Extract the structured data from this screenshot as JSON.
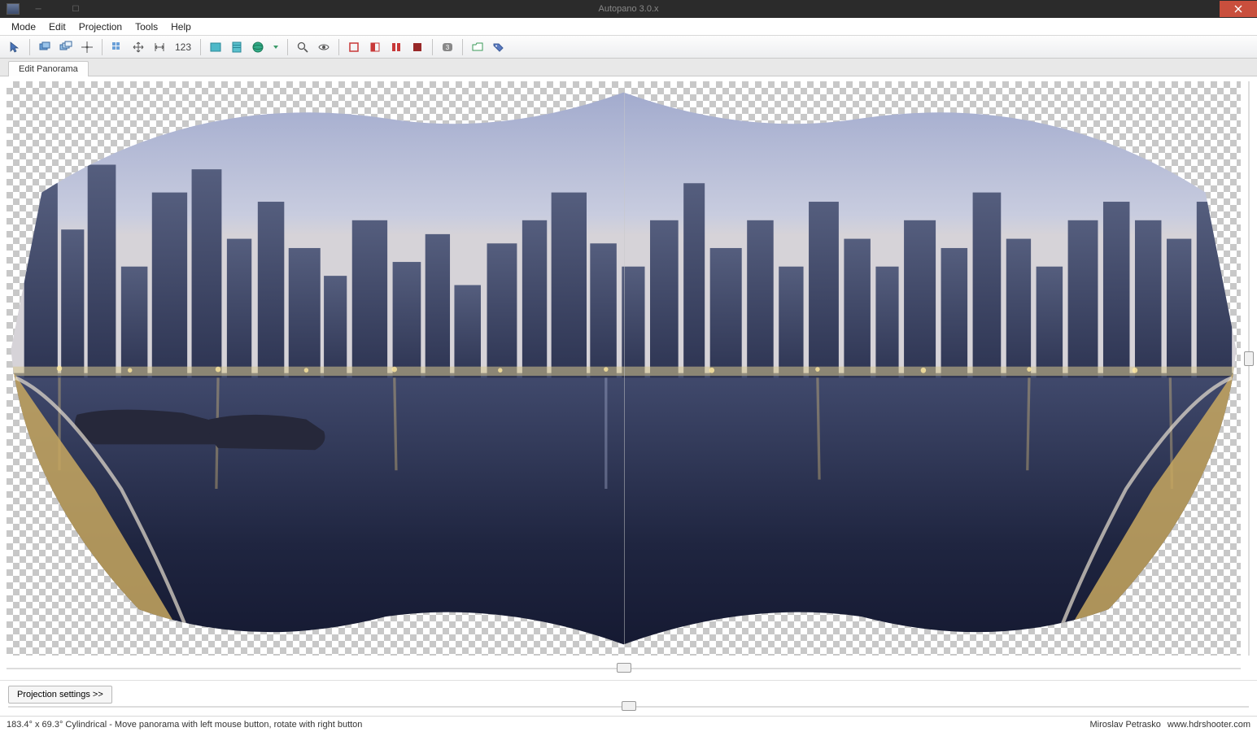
{
  "titlebar": {
    "title": "Autopano 3.0.x"
  },
  "menu": {
    "items": [
      "Mode",
      "Edit",
      "Projection",
      "Tools",
      "Help"
    ]
  },
  "toolbar": {
    "group1": [
      "select-tool",
      "move-images-tool",
      "move-group-tool",
      "center-tool"
    ],
    "group2": [
      "grid-tool",
      "crosshair-center-tool",
      "align-tool"
    ],
    "numbers_label": "123",
    "group3": [
      "image-info-tool",
      "layers-tool",
      "sphere-tool",
      "dropdown-tool"
    ],
    "group4": [
      "zoom-tool",
      "eye-tool"
    ],
    "group5": [
      "flag-red-1",
      "flag-red-2",
      "flag-red-3",
      "flag-red-4"
    ],
    "group6": [
      "badge-3-tool"
    ],
    "group7": [
      "folder-tool",
      "tag-tool"
    ]
  },
  "tabs": {
    "active": "Edit Panorama"
  },
  "projection_button": "Projection settings >>",
  "status": {
    "left": "183.4° x 69.3° Cylindrical - Move panorama with left mouse button, rotate with right button",
    "right_author": "Miroslav Petrasko",
    "right_url": "www.hdrshooter.com"
  },
  "panorama": {
    "projection": "Cylindrical",
    "fov_h_deg": 183.4,
    "fov_v_deg": 69.3
  }
}
